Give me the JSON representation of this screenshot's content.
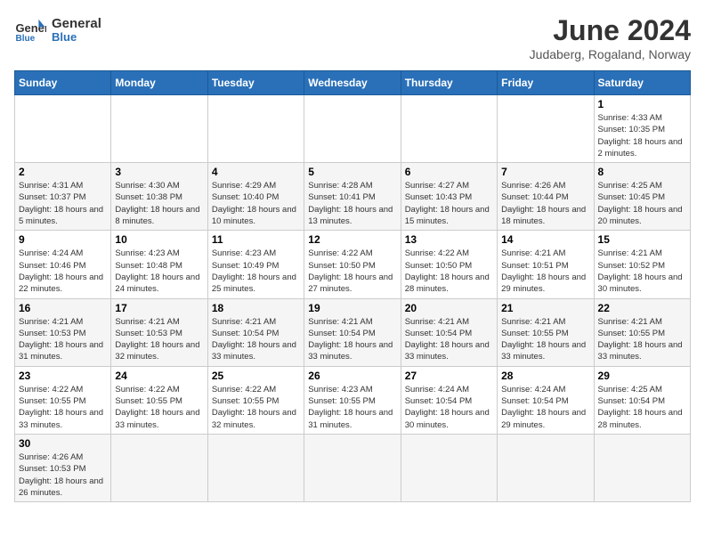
{
  "header": {
    "logo_general": "General",
    "logo_blue": "Blue",
    "month_title": "June 2024",
    "subtitle": "Judaberg, Rogaland, Norway"
  },
  "weekdays": [
    "Sunday",
    "Monday",
    "Tuesday",
    "Wednesday",
    "Thursday",
    "Friday",
    "Saturday"
  ],
  "weeks": [
    [
      {
        "day": "",
        "info": ""
      },
      {
        "day": "",
        "info": ""
      },
      {
        "day": "",
        "info": ""
      },
      {
        "day": "",
        "info": ""
      },
      {
        "day": "",
        "info": ""
      },
      {
        "day": "",
        "info": ""
      },
      {
        "day": "1",
        "info": "Sunrise: 4:33 AM\nSunset: 10:35 PM\nDaylight: 18 hours and 2 minutes."
      }
    ],
    [
      {
        "day": "2",
        "info": "Sunrise: 4:31 AM\nSunset: 10:37 PM\nDaylight: 18 hours and 5 minutes."
      },
      {
        "day": "3",
        "info": "Sunrise: 4:30 AM\nSunset: 10:38 PM\nDaylight: 18 hours and 8 minutes."
      },
      {
        "day": "4",
        "info": "Sunrise: 4:29 AM\nSunset: 10:40 PM\nDaylight: 18 hours and 10 minutes."
      },
      {
        "day": "5",
        "info": "Sunrise: 4:28 AM\nSunset: 10:41 PM\nDaylight: 18 hours and 13 minutes."
      },
      {
        "day": "6",
        "info": "Sunrise: 4:27 AM\nSunset: 10:43 PM\nDaylight: 18 hours and 15 minutes."
      },
      {
        "day": "7",
        "info": "Sunrise: 4:26 AM\nSunset: 10:44 PM\nDaylight: 18 hours and 18 minutes."
      },
      {
        "day": "8",
        "info": "Sunrise: 4:25 AM\nSunset: 10:45 PM\nDaylight: 18 hours and 20 minutes."
      }
    ],
    [
      {
        "day": "9",
        "info": "Sunrise: 4:24 AM\nSunset: 10:46 PM\nDaylight: 18 hours and 22 minutes."
      },
      {
        "day": "10",
        "info": "Sunrise: 4:23 AM\nSunset: 10:48 PM\nDaylight: 18 hours and 24 minutes."
      },
      {
        "day": "11",
        "info": "Sunrise: 4:23 AM\nSunset: 10:49 PM\nDaylight: 18 hours and 25 minutes."
      },
      {
        "day": "12",
        "info": "Sunrise: 4:22 AM\nSunset: 10:50 PM\nDaylight: 18 hours and 27 minutes."
      },
      {
        "day": "13",
        "info": "Sunrise: 4:22 AM\nSunset: 10:50 PM\nDaylight: 18 hours and 28 minutes."
      },
      {
        "day": "14",
        "info": "Sunrise: 4:21 AM\nSunset: 10:51 PM\nDaylight: 18 hours and 29 minutes."
      },
      {
        "day": "15",
        "info": "Sunrise: 4:21 AM\nSunset: 10:52 PM\nDaylight: 18 hours and 30 minutes."
      }
    ],
    [
      {
        "day": "16",
        "info": "Sunrise: 4:21 AM\nSunset: 10:53 PM\nDaylight: 18 hours and 31 minutes."
      },
      {
        "day": "17",
        "info": "Sunrise: 4:21 AM\nSunset: 10:53 PM\nDaylight: 18 hours and 32 minutes."
      },
      {
        "day": "18",
        "info": "Sunrise: 4:21 AM\nSunset: 10:54 PM\nDaylight: 18 hours and 33 minutes."
      },
      {
        "day": "19",
        "info": "Sunrise: 4:21 AM\nSunset: 10:54 PM\nDaylight: 18 hours and 33 minutes."
      },
      {
        "day": "20",
        "info": "Sunrise: 4:21 AM\nSunset: 10:54 PM\nDaylight: 18 hours and 33 minutes."
      },
      {
        "day": "21",
        "info": "Sunrise: 4:21 AM\nSunset: 10:55 PM\nDaylight: 18 hours and 33 minutes."
      },
      {
        "day": "22",
        "info": "Sunrise: 4:21 AM\nSunset: 10:55 PM\nDaylight: 18 hours and 33 minutes."
      }
    ],
    [
      {
        "day": "23",
        "info": "Sunrise: 4:22 AM\nSunset: 10:55 PM\nDaylight: 18 hours and 33 minutes."
      },
      {
        "day": "24",
        "info": "Sunrise: 4:22 AM\nSunset: 10:55 PM\nDaylight: 18 hours and 33 minutes."
      },
      {
        "day": "25",
        "info": "Sunrise: 4:22 AM\nSunset: 10:55 PM\nDaylight: 18 hours and 32 minutes."
      },
      {
        "day": "26",
        "info": "Sunrise: 4:23 AM\nSunset: 10:55 PM\nDaylight: 18 hours and 31 minutes."
      },
      {
        "day": "27",
        "info": "Sunrise: 4:24 AM\nSunset: 10:54 PM\nDaylight: 18 hours and 30 minutes."
      },
      {
        "day": "28",
        "info": "Sunrise: 4:24 AM\nSunset: 10:54 PM\nDaylight: 18 hours and 29 minutes."
      },
      {
        "day": "29",
        "info": "Sunrise: 4:25 AM\nSunset: 10:54 PM\nDaylight: 18 hours and 28 minutes."
      }
    ],
    [
      {
        "day": "30",
        "info": "Sunrise: 4:26 AM\nSunset: 10:53 PM\nDaylight: 18 hours and 26 minutes."
      },
      {
        "day": "",
        "info": ""
      },
      {
        "day": "",
        "info": ""
      },
      {
        "day": "",
        "info": ""
      },
      {
        "day": "",
        "info": ""
      },
      {
        "day": "",
        "info": ""
      },
      {
        "day": "",
        "info": ""
      }
    ]
  ]
}
